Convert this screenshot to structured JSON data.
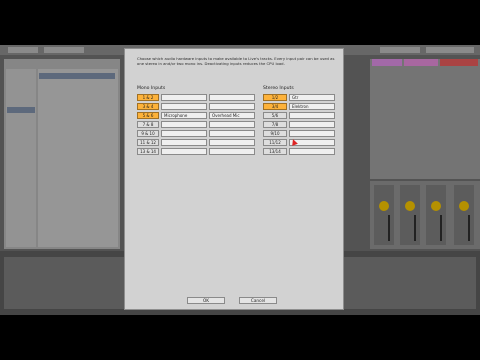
{
  "dialog": {
    "description": "Choose which audio hardware inputs to make available to Live's tracks. Every input pair can be used as one stereo in and/or two mono ins. Deactivating inputs reduces the CPU load.",
    "mono_header": "Mono Inputs",
    "stereo_header": "Stereo Inputs",
    "mono_rows": [
      {
        "toggle": "1 & 2",
        "active": true,
        "name_a": "",
        "name_b": ""
      },
      {
        "toggle": "3 & 4",
        "active": true,
        "name_a": "",
        "name_b": ""
      },
      {
        "toggle": "5 & 6",
        "active": true,
        "name_a": "Microphone",
        "name_b": "Overhead Mic"
      },
      {
        "toggle": "7 & 8",
        "active": false,
        "name_a": "",
        "name_b": ""
      },
      {
        "toggle": "9 & 10",
        "active": false,
        "name_a": "",
        "name_b": ""
      },
      {
        "toggle": "11 & 12",
        "active": false,
        "name_a": "",
        "name_b": ""
      },
      {
        "toggle": "13 & 14",
        "active": false,
        "name_a": "",
        "name_b": ""
      }
    ],
    "stereo_rows": [
      {
        "toggle": "1/2",
        "active": true,
        "name": "Gtr"
      },
      {
        "toggle": "3/4",
        "active": true,
        "name": "Elektron"
      },
      {
        "toggle": "5/6",
        "active": false,
        "name": ""
      },
      {
        "toggle": "7/8",
        "active": false,
        "name": ""
      },
      {
        "toggle": "9/10",
        "active": false,
        "name": ""
      },
      {
        "toggle": "11/12",
        "active": false,
        "name": ""
      },
      {
        "toggle": "13/14",
        "active": false,
        "name": ""
      }
    ],
    "ok_label": "OK",
    "cancel_label": "Cancel"
  },
  "colors": {
    "active": "#fdb23a",
    "dialog_bg": "#d2d2d2",
    "mixer_knob": "#f2c200"
  }
}
